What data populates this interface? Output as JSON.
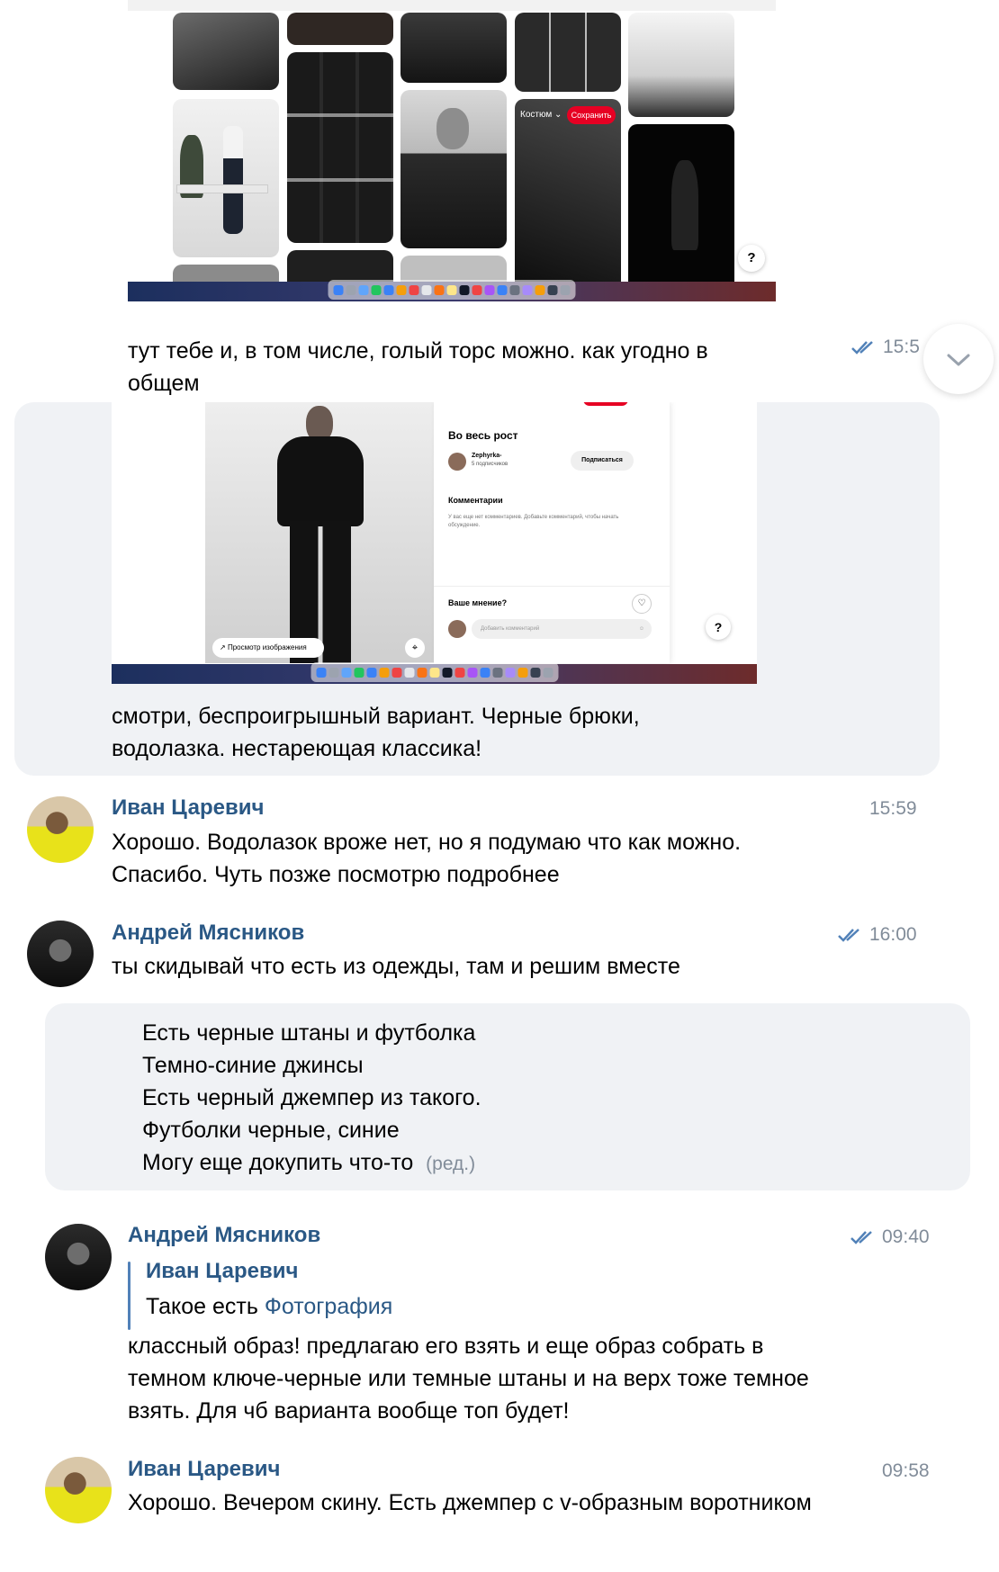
{
  "messages": {
    "m0": {
      "text": "тут тебе и, в том числе, голый торс можно. как угодно в общем",
      "time": "15:5"
    },
    "m1": {
      "shot": {
        "title": "Во весь рост",
        "author": "Zephyrka-",
        "followers": "5 подписчиков",
        "subscribe": "Подписаться",
        "comments_title": "Комментарии",
        "no_comments": "У вас еще нет комментариев. Добавьте комментарий, чтобы начать обсуждение.",
        "opinion": "Ваше мнение?",
        "add_comment": "Добавить комментарий",
        "view_image": "Просмотр изображения",
        "help": "?"
      },
      "text": "смотри, беспроигрышный вариант. Черные брюки, водолазка. нестареющая классика!"
    },
    "m2": {
      "author": "Иван Царевич",
      "time": "15:59",
      "text": "Хорошо. Водолазок вроже нет, но я подумаю что как можно. Спасибо. Чуть позже посмотрю подробнее"
    },
    "m3": {
      "author": "Андрей Мясников",
      "time": "16:00",
      "text": "ты скидывай что есть из одежды, там и решим вместе"
    },
    "m4": {
      "lines": [
        "Есть черные штаны и футболка",
        "Темно-синие джинсы",
        "Есть черный джемпер из такого.",
        "Футболки черные, синие",
        "Могу еще докупить что-то"
      ],
      "edited": "(ред.)"
    },
    "m5": {
      "author": "Андрей Мясников",
      "time": "09:40",
      "reply_author": "Иван Царевич",
      "reply_text": "Такое есть",
      "reply_link": "Фотография",
      "text": "классный образ! предлагаю его взять и еще образ собрать в темном ключе-черные или темные штаны и на верх тоже темное взять. Для чб варианта вообще топ будет!"
    },
    "m6": {
      "author": "Иван Царевич",
      "time": "09:58",
      "text": "Хорошо. Вечером скину. Есть джемпер с v-образным воротником"
    }
  },
  "top_shot": {
    "board": "Костюм",
    "save": "Сохранить",
    "help": "?"
  },
  "icons": {
    "scroll_down": "chevron-down-icon",
    "read_status": "double-check-icon"
  },
  "colors": {
    "name": "#2a5885",
    "time": "#818c99",
    "highlight": "#f0f2f5",
    "save_button": "#e60023"
  }
}
